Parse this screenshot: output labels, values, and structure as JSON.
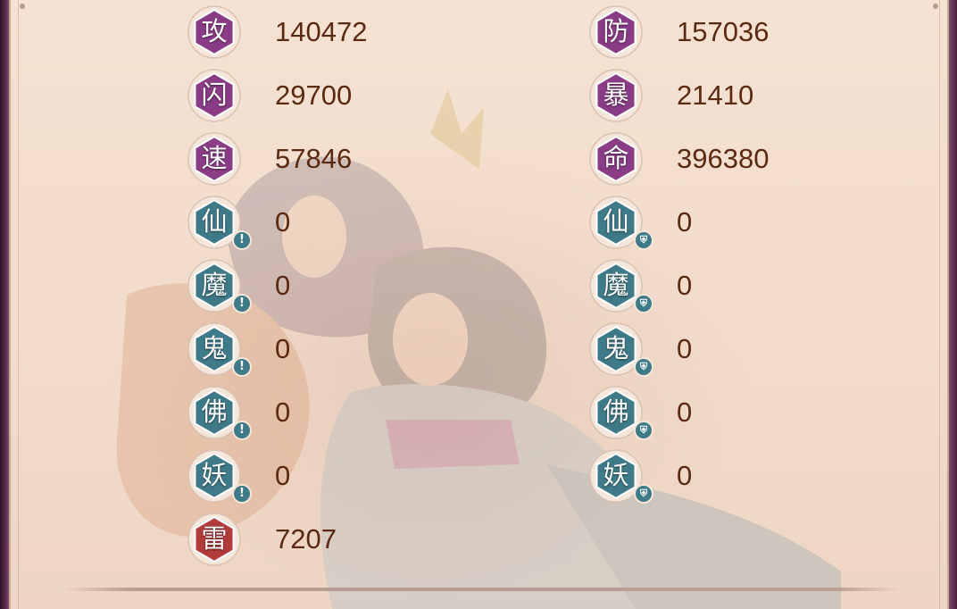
{
  "colors": {
    "attr_hex": "#8a3d86",
    "element_hex": "#3f7a88",
    "thunder_hex": "#b23a3a",
    "value_text": "#5a2a12"
  },
  "attack_col": [
    {
      "icon": "攻",
      "value": "140472",
      "kind": "attr"
    },
    {
      "icon": "闪",
      "value": "29700",
      "kind": "attr"
    },
    {
      "icon": "速",
      "value": "57846",
      "kind": "attr"
    },
    {
      "icon": "仙",
      "value": "0",
      "kind": "element",
      "badge": "attack-badge-icon"
    },
    {
      "icon": "魔",
      "value": "0",
      "kind": "element",
      "badge": "attack-badge-icon"
    },
    {
      "icon": "鬼",
      "value": "0",
      "kind": "element",
      "badge": "attack-badge-icon"
    },
    {
      "icon": "佛",
      "value": "0",
      "kind": "element",
      "badge": "attack-badge-icon"
    },
    {
      "icon": "妖",
      "value": "0",
      "kind": "element",
      "badge": "attack-badge-icon"
    },
    {
      "icon": "雷",
      "value": "7207",
      "kind": "thunder"
    }
  ],
  "defense_col": [
    {
      "icon": "防",
      "value": "157036",
      "kind": "attr"
    },
    {
      "icon": "暴",
      "value": "21410",
      "kind": "attr"
    },
    {
      "icon": "命",
      "value": "396380",
      "kind": "attr"
    },
    {
      "icon": "仙",
      "value": "0",
      "kind": "element",
      "badge": "shield-badge-icon"
    },
    {
      "icon": "魔",
      "value": "0",
      "kind": "element",
      "badge": "shield-badge-icon"
    },
    {
      "icon": "鬼",
      "value": "0",
      "kind": "element",
      "badge": "shield-badge-icon"
    },
    {
      "icon": "佛",
      "value": "0",
      "kind": "element",
      "badge": "shield-badge-icon"
    },
    {
      "icon": "妖",
      "value": "0",
      "kind": "element",
      "badge": "shield-badge-icon"
    }
  ]
}
